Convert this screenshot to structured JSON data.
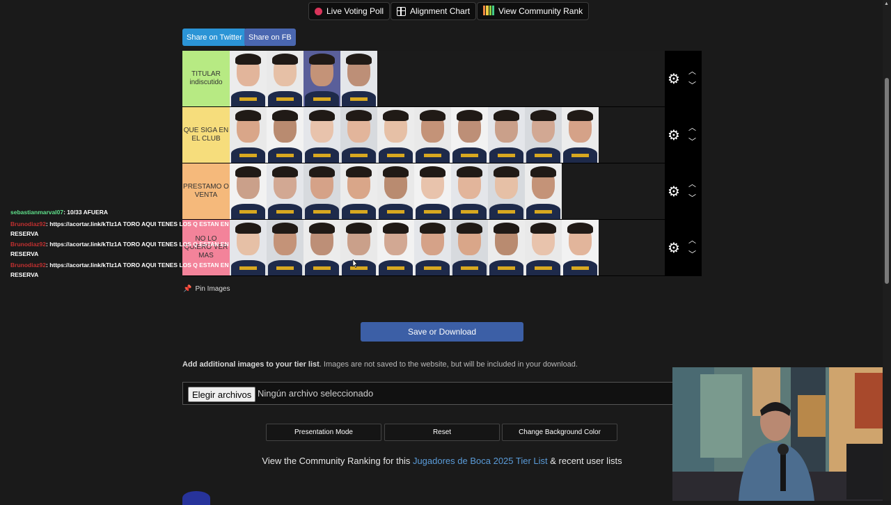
{
  "top_buttons": {
    "live_voting": "Live Voting Poll",
    "alignment_chart": "Alignment Chart",
    "community_rank": "View Community Rank"
  },
  "share": {
    "twitter": "Share on Twitter",
    "fb": "Share on FB"
  },
  "colors": {
    "twitter": "#2b94d6",
    "fb": "#4a67b0",
    "save": "#3c5fa6",
    "link": "#5a9bd8"
  },
  "tiers": [
    {
      "label": "TITULAR indiscutido",
      "color": "#b7ea83",
      "count": 4
    },
    {
      "label": "QUE SIGA EN EL CLUB",
      "color": "#f6dd7c",
      "count": 10
    },
    {
      "label": "PRESTAMO O VENTA",
      "color": "#f5b97b",
      "count": 9
    },
    {
      "label": "NO LO QUIERO VER MAS",
      "color": "#f3839a",
      "count": 10
    }
  ],
  "chat": [
    {
      "user": "sebastianmarval07",
      "message": ": 10/33 AFUERA"
    },
    {
      "user": "Brunodiaz92",
      "message": ": https://acortar.link/kTIz1A TORO AQUI TENES LOS Q ESTAN EN",
      "cont": "RESERVA"
    },
    {
      "user": "Brunodiaz92",
      "message": ": https://acortar.link/kTIz1A TORO AQUI TENES LOS Q ESTAN EN",
      "cont": "RESERVA"
    },
    {
      "user": "Brunodiaz92",
      "message": ": https://acortar.link/kTIz1A TORO AQUI TENES LOS Q ESTAN EN",
      "cont": "RESERVA"
    }
  ],
  "pin_images": "Pin Images",
  "save_button": "Save or Download",
  "add_images": {
    "bold": "Add additional images to your tier list",
    "rest": ". Images are not saved to the website, but will be included in your download."
  },
  "file_input": {
    "button": "Elegir archivos",
    "status": "Ningún archivo seleccionado"
  },
  "bottom_buttons": {
    "presentation": "Presentation Mode",
    "reset": "Reset",
    "background": "Change Background Color"
  },
  "community": {
    "prefix": "View the Community Ranking for this ",
    "link": "Jugadores de Boca 2025 Tier List",
    "suffix": " & recent user lists"
  },
  "icons": {
    "live_voting": "red-dot-icon",
    "alignment_chart": "grid-icon",
    "community_rank": "mosaic-icon",
    "tier_settings": "gear-icon",
    "move_up": "chevron-up-icon",
    "move_down": "chevron-down-icon",
    "pin": "pin-icon"
  }
}
